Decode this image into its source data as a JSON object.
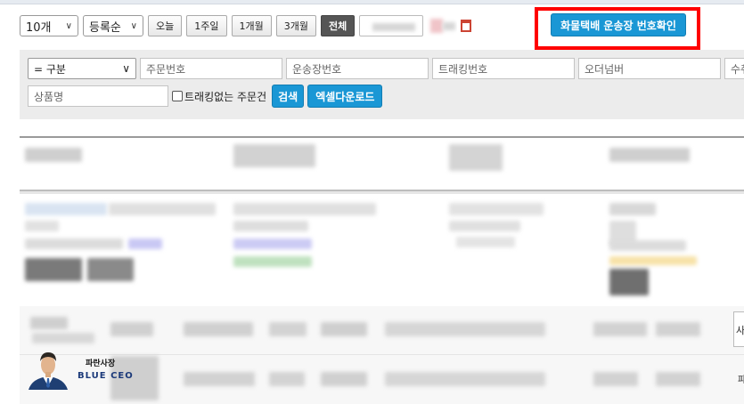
{
  "toolbar": {
    "page_size": "10개",
    "sort": "등록순",
    "range_buttons": [
      "오늘",
      "1주일",
      "1개월",
      "3개월",
      "전체"
    ],
    "active_range": "전체",
    "freight_button": "화물택배 운송장 번호확인"
  },
  "filters": {
    "division_select": "= 구분",
    "order_no_placeholder": "주문번호",
    "waybill_placeholder": "운송장번호",
    "tracking_placeholder": "트래킹번호",
    "order_number_placeholder": "오더넘버",
    "partial_field_placeholder": "수취",
    "product_name_placeholder": "상품명",
    "no_tracking_label": "트래킹없는 주문건",
    "search_button": "검색",
    "excel_button": "엑셀다운로드"
  },
  "logo": {
    "line1": "파란사장",
    "line2": "BLUE CEO"
  },
  "side_edge_chars": [
    "사",
    "파"
  ],
  "colors": {
    "accent_blue": "#1a97d5",
    "highlight_red": "#ff0000",
    "active_button": "#555555"
  }
}
